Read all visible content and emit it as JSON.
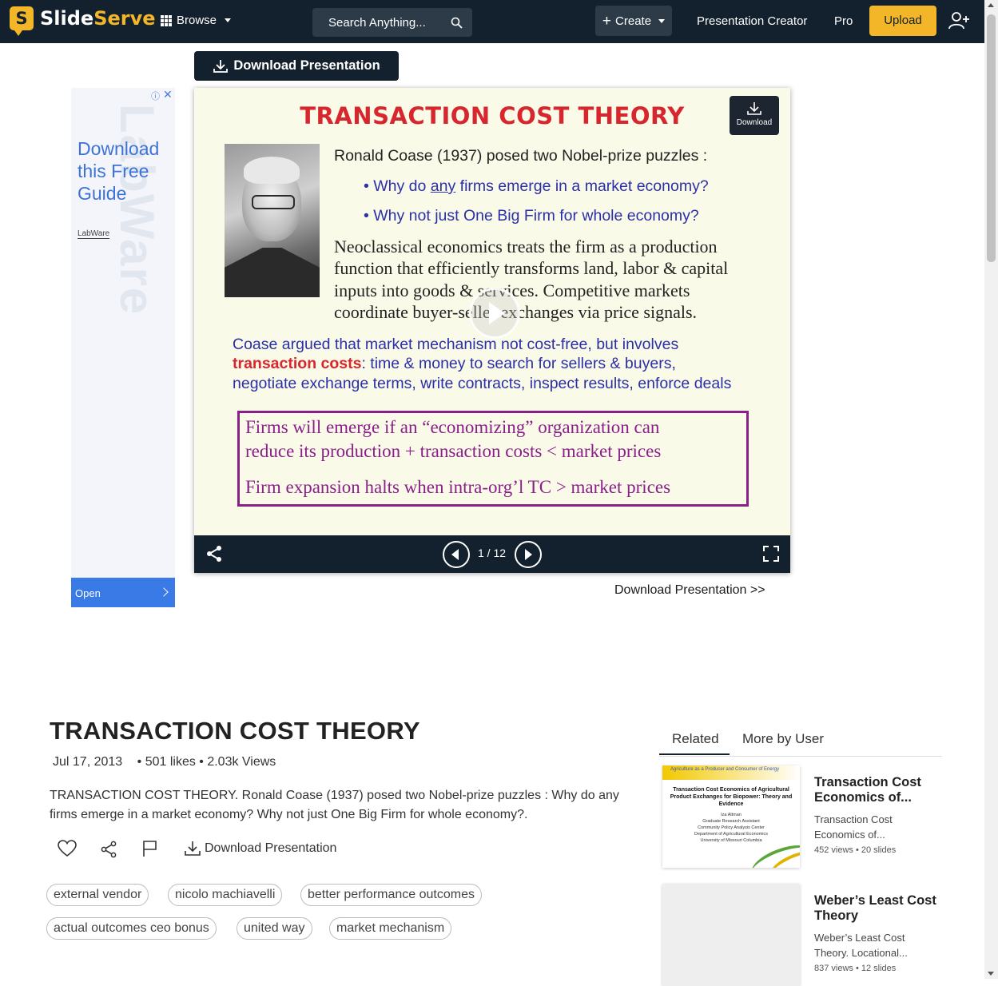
{
  "header": {
    "logo_letter": "S",
    "logo_text_white": "Slide",
    "logo_text_yellow": "Serve",
    "browse_label": "Browse",
    "search_placeholder": "Search Anything...",
    "create_label": "Create",
    "presentation_creator_label": "Presentation Creator",
    "pro_label": "Pro",
    "upload_label": "Upload"
  },
  "download_top_label": "Download Presentation",
  "ad": {
    "headline": "Download this Free Guide",
    "brand": "LabWare",
    "watermark": "LabWare",
    "open_label": "Open"
  },
  "slide": {
    "title": "TRANSACTION COST THEORY",
    "line1": "Ronald Coase (1937) posed two Nobel-prize puzzles :",
    "bullet1_pre": "• Why do ",
    "bullet1_u": "any",
    "bullet1_post": " firms emerge in a market economy?",
    "bullet2": "• Why not just One Big Firm for whole economy?",
    "neo1": "Neoclassical economics treats the firm as a production",
    "neo2": "function that efficiently transforms land, labor & capital",
    "neo3": "inputs into goods & services.  Competitive markets",
    "neo4": "coordinate buyer-seller exchanges via price signals.",
    "coase1": "Coase argued that market mechanism not cost-free, but involves",
    "coase2_red": "transaction costs",
    "coase2_rest": ": time & money to search for sellers & buyers,",
    "coase3": "negotiate exchange terms, write contracts, inspect results, enforce deals",
    "box1": "Firms will emerge if an “economizing” organization can",
    "box2": "reduce its production + transaction costs < market prices",
    "box3": "Firm expansion halts when intra-org’l TC > market prices",
    "mini_download_label": "Download"
  },
  "player": {
    "page_current": 1,
    "page_total": 12,
    "pager_text": "1 / 12"
  },
  "download_link_label": "Download Presentation >>",
  "doc": {
    "title": "TRANSACTION COST THEORY",
    "date": "Jul 17, 2013",
    "meta": "• 501 likes • 2.03k Views",
    "description": "TRANSACTION COST THEORY. Ronald Coase (1937) posed two Nobel-prize puzzles : Why do any firms emerge in a market economy? Why not just One Big Firm for whole economy?.",
    "download_label": "Download Presentation",
    "tags": [
      "external vendor",
      "nicolo machiavelli",
      "better performance outcomes",
      "actual outcomes ceo bonus",
      "united way",
      "market mechanism"
    ]
  },
  "related": {
    "tab_related": "Related",
    "tab_more": "More by User",
    "items": [
      {
        "title": "Transaction Cost Economics of...",
        "desc": "Transaction Cost Economics of...",
        "meta": "452 views • 20 slides",
        "thumb_header": "Agriculture as a Producer and Consumer of Energy",
        "thumb_title": "Transaction Cost Economics of Agricultural Product Exchanges for Biopower: Theory and Evidence",
        "thumb_lines": [
          "Iza Altman",
          "Graduate Research Assistant",
          "Community Policy Analysis Center",
          "Department of Agricultural Economics",
          "University of Missouri Columbia"
        ]
      },
      {
        "title": "Weber’s Least Cost Theory",
        "desc": "Weber’s Least Cost Theory. Locational...",
        "meta": "837 views • 12 slides"
      }
    ]
  }
}
